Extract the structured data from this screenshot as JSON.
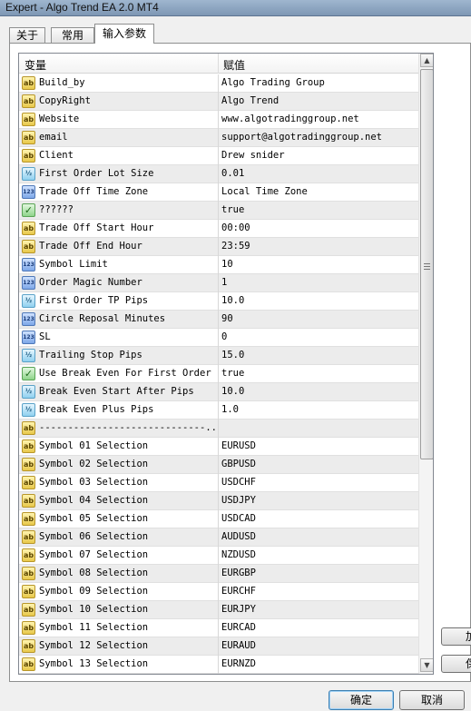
{
  "window": {
    "title": "Expert - Algo Trend EA 2.0 MT4"
  },
  "tabs": [
    {
      "label": "关于"
    },
    {
      "label": "常用"
    },
    {
      "label": "输入参数"
    }
  ],
  "table": {
    "columns": [
      "变量",
      "赋值"
    ],
    "rows": [
      {
        "icon": "string-icon",
        "name": "Build_by",
        "value": "Algo Trading Group"
      },
      {
        "icon": "string-icon",
        "name": "CopyRight",
        "value": "Algo Trend"
      },
      {
        "icon": "string-icon",
        "name": "Website",
        "value": "www.algotradinggroup.net"
      },
      {
        "icon": "string-icon",
        "name": "email",
        "value": "support@algotradinggroup.net"
      },
      {
        "icon": "string-icon",
        "name": "Client",
        "value": "Drew snider"
      },
      {
        "icon": "double-icon",
        "name": "First Order Lot Size",
        "value": "0.01"
      },
      {
        "icon": "integer-icon",
        "name": "Trade Off Time Zone",
        "value": "Local Time Zone"
      },
      {
        "icon": "bool-icon",
        "name": "??????",
        "value": "true"
      },
      {
        "icon": "string-icon",
        "name": "Trade Off Start Hour",
        "value": "00:00"
      },
      {
        "icon": "string-icon",
        "name": "Trade Off End Hour",
        "value": "23:59"
      },
      {
        "icon": "integer-icon",
        "name": "Symbol Limit",
        "value": "10"
      },
      {
        "icon": "integer-icon",
        "name": "Order Magic Number",
        "value": "1"
      },
      {
        "icon": "double-icon",
        "name": "First Order TP Pips",
        "value": "10.0"
      },
      {
        "icon": "integer-icon",
        "name": "Circle Reposal Minutes",
        "value": "90"
      },
      {
        "icon": "integer-icon",
        "name": "SL",
        "value": "0"
      },
      {
        "icon": "double-icon",
        "name": "Trailing Stop Pips",
        "value": "15.0"
      },
      {
        "icon": "bool-icon",
        "name": "Use Break Even For First Order",
        "value": "true"
      },
      {
        "icon": "double-icon",
        "name": "Break Even Start After Pips",
        "value": "10.0"
      },
      {
        "icon": "double-icon",
        "name": "Break Even Plus Pips",
        "value": "1.0"
      },
      {
        "icon": "string-icon",
        "name": "-----------------------------...",
        "value": ""
      },
      {
        "icon": "string-icon",
        "name": "Symbol 01 Selection",
        "value": "EURUSD"
      },
      {
        "icon": "string-icon",
        "name": "Symbol 02 Selection",
        "value": "GBPUSD"
      },
      {
        "icon": "string-icon",
        "name": "Symbol 03 Selection",
        "value": "USDCHF"
      },
      {
        "icon": "string-icon",
        "name": "Symbol 04 Selection",
        "value": "USDJPY"
      },
      {
        "icon": "string-icon",
        "name": "Symbol 05 Selection",
        "value": "USDCAD"
      },
      {
        "icon": "string-icon",
        "name": "Symbol 06 Selection",
        "value": "AUDUSD"
      },
      {
        "icon": "string-icon",
        "name": "Symbol 07 Selection",
        "value": "NZDUSD"
      },
      {
        "icon": "string-icon",
        "name": "Symbol 08 Selection",
        "value": "EURGBP"
      },
      {
        "icon": "string-icon",
        "name": "Symbol 09 Selection",
        "value": "EURCHF"
      },
      {
        "icon": "string-icon",
        "name": "Symbol 10 Selection",
        "value": "EURJPY"
      },
      {
        "icon": "string-icon",
        "name": "Symbol 11 Selection",
        "value": "EURCAD"
      },
      {
        "icon": "string-icon",
        "name": "Symbol 12 Selection",
        "value": "EURAUD"
      },
      {
        "icon": "string-icon",
        "name": "Symbol 13 Selection",
        "value": "EURNZD"
      }
    ]
  },
  "side_buttons": [
    {
      "label": "加"
    },
    {
      "label": "保"
    }
  ],
  "buttons": {
    "ok": "确定",
    "cancel": "取消"
  }
}
